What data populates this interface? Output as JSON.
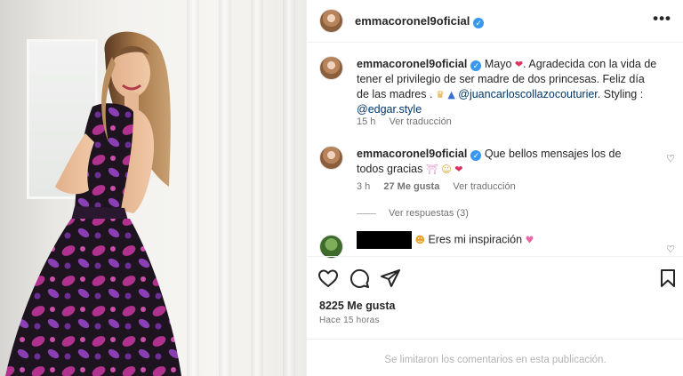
{
  "post": {
    "username": "emmacoronel9oficial",
    "more_label": "•••"
  },
  "caption": {
    "username": "emmacoronel9oficial",
    "text_1": "Mayo",
    "text_2": ". Agradecida con la vida de tener el privilegio de ser madre de dos princesas. Feliz día de las madres .",
    "mention_1": "@juancarloscollazocouturier",
    "text_3": ". Styling :",
    "mention_2": "@edgar.style",
    "time": "15 h",
    "translate": "Ver traducción"
  },
  "reply": {
    "username": "emmacoronel9oficial",
    "text": "Que bellos mensajes los de todos gracias",
    "time": "3 h",
    "likes": "27 Me gusta",
    "translate": "Ver traducción",
    "view_replies": "Ver respuestas (3)"
  },
  "comment2": {
    "text": "Eres mi inspiración"
  },
  "stats": {
    "likes": "8225 Me gusta",
    "time": "Hace 15 horas"
  },
  "footer": {
    "text": "Se limitaron los comentarios en esta publicación."
  }
}
